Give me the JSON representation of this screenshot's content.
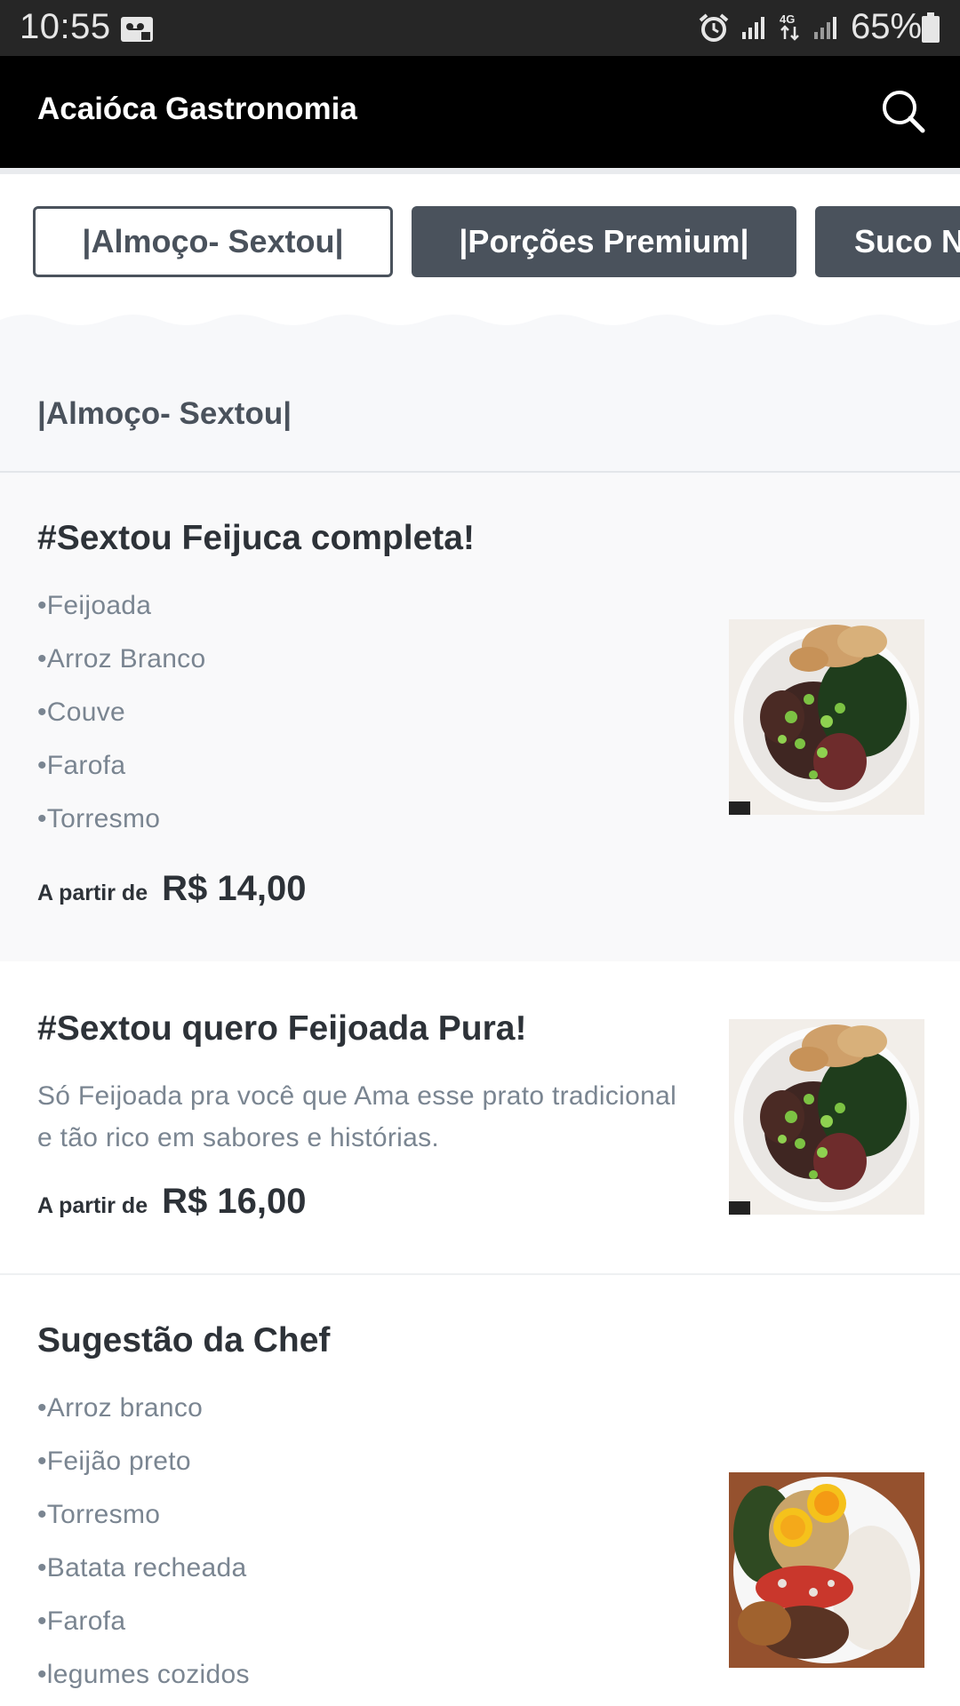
{
  "status_bar": {
    "time": "10:55",
    "battery_percent": "65%",
    "icons": [
      "voicemail-icon",
      "alarm-icon",
      "signal-icon",
      "4g-data-icon",
      "signal-icon",
      "battery-icon"
    ]
  },
  "header": {
    "title": "Acaióca Gastronomia",
    "search_icon": "search-icon"
  },
  "tabs": [
    {
      "label": "|Almoço- Sextou|",
      "active": true
    },
    {
      "label": "|Porções Premium|",
      "active": false
    },
    {
      "label": "Suco N",
      "active": false
    }
  ],
  "section": {
    "title": "|Almoço- Sextou|"
  },
  "products": [
    {
      "title": "#Sextou Feijuca completa!",
      "items": [
        "•Feijoada",
        "•Arroz Branco",
        "•Couve",
        "•Farofa",
        "•Torresmo"
      ],
      "price_prefix": "A partir de",
      "price": "R$ 14,00",
      "image": "feijoada-plate-image"
    },
    {
      "title": "#Sextou quero Feijoada Pura!",
      "description": "Só Feijoada pra você que Ama esse prato tradicional e tão rico em sabores e histórias.",
      "price_prefix": "A partir de",
      "price": "R$ 16,00",
      "image": "feijoada-plate-image"
    },
    {
      "title": "Sugestão da Chef",
      "items": [
        "•Arroz branco",
        "•Feijão preto",
        "•Torresmo",
        "•Batata recheada",
        "•Farofa",
        "•legumes cozidos"
      ],
      "image": "chef-suggestion-plate-image"
    }
  ],
  "colors": {
    "status_bar": "#262626",
    "header": "#000000",
    "tab_dark": "#4a525c",
    "text_dark": "#2d3238",
    "text_muted": "#7a8591",
    "background": "#f7f8fa"
  }
}
